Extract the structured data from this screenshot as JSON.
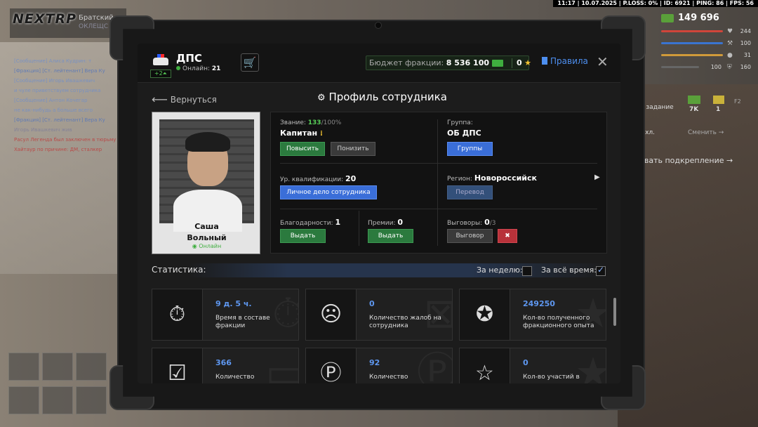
{
  "hud": {
    "topbar": "11:17 | 10.07.2025 | P.LOSS: 0% | ID: 6921 | PING: 86 | FPS: 56",
    "logo": "NEXTRP",
    "server": "Братский",
    "server_sub": "ОКЛЕЩС",
    "money": "149 696",
    "stats": [
      {
        "icon": "♥",
        "value": "244",
        "color": "#d0453a"
      },
      {
        "icon": "⚒",
        "value": "100",
        "color": "#3a74d0"
      },
      {
        "icon": "🍖",
        "value": "31",
        "color": "#d09a3a"
      },
      {
        "icon": "🛡",
        "value": "160",
        "color": "#888888"
      }
    ],
    "armor_val": "100",
    "side_task": "е задание",
    "side_cash": "7K",
    "side_gold": "1",
    "side_key": "F2",
    "side_exit": "ыхл.",
    "side_change": "Сменить →",
    "side_call": "звать подкрепление →",
    "chat": [
      "[Сообщение] Алиса Кудрин: т",
      "[Фракция] [Ст. лейтенант] Вера Ку",
      "[Сообщение] Игорь Ивашкевич",
      "и чуле приветствуем сотрудника",
      "[Сообщение] Антон Кочегар",
      "не как-нибудь а больше всего",
      "[Фракция] [Ст. лейтенант] Вера Ку",
      "Игорь Ивашкевич жив",
      "Расул Легенда был заключен в тюрьму",
      "Хайтаур по причине: ДМ, сталкер"
    ]
  },
  "header": {
    "department": "ДПС",
    "badge": "+2⏶",
    "online_label": "Онлайн:",
    "online_count": "21",
    "budget_label": "Бюджет фракции:",
    "budget_value": "8 536 100",
    "stars_value": "0",
    "rules_label": "Правила",
    "close": "✕"
  },
  "nav": {
    "back_label": "Вернуться",
    "title": "Профиль сотрудника"
  },
  "profile": {
    "first_name": "Саша",
    "last_name": "Вольный",
    "status": "Онлайн"
  },
  "details": {
    "rank_label": "Звание:",
    "rank_progress": "133",
    "rank_total": "/100%",
    "rank_value": "Капитан",
    "promote": "Повысить",
    "demote": "Понизить",
    "group_label": "Группа:",
    "group_value": "ОБ ДПС",
    "groups_btn": "Группы",
    "qual_label": "Ур. квалификации:",
    "qual_value": "20",
    "dossier_btn": "Личное дело сотрудника",
    "region_label": "Регион:",
    "region_value": "Новороссийск",
    "transfer_btn": "Перевод",
    "thanks_label": "Благодарности:",
    "thanks_value": "1",
    "thanks_btn": "Выдать",
    "bonus_label": "Премии:",
    "bonus_value": "0",
    "bonus_btn": "Выдать",
    "warn_label": "Выговоры:",
    "warn_value": "0",
    "warn_total": "/3",
    "warn_btn": "Выговор"
  },
  "stats": {
    "label": "Статистика:",
    "week_label": "За неделю:",
    "all_label": "За всё время:",
    "week_checked": false,
    "all_checked": true,
    "tiles": [
      {
        "value": "9 д. 5 ч.",
        "text": "Время в составе фракции",
        "icon": "⏱"
      },
      {
        "value": "0",
        "text": "Количество жалоб на сотрудника",
        "icon": "📋"
      },
      {
        "value": "249250",
        "text": "Кол-во полученного фракционного опыта",
        "icon": "★"
      },
      {
        "value": "366",
        "text": "Количество",
        "icon": "📋"
      },
      {
        "value": "92",
        "text": "Количество",
        "icon": "🗒"
      },
      {
        "value": "0",
        "text": "Кол-во участий в",
        "icon": "☆"
      }
    ]
  }
}
